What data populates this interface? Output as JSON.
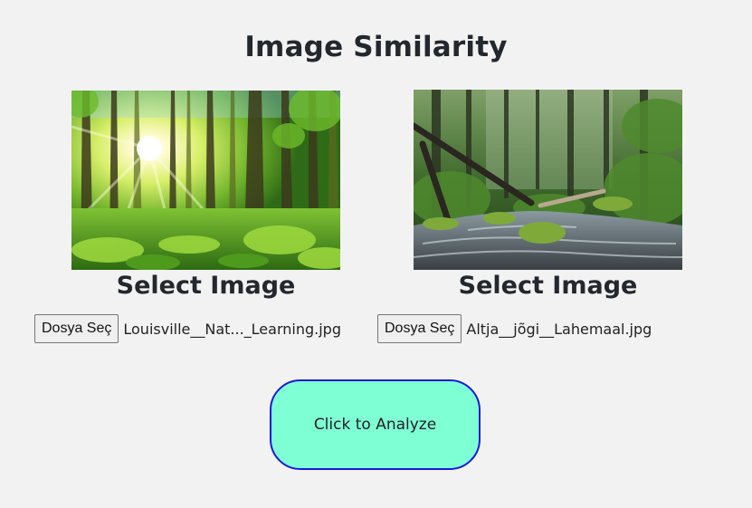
{
  "page": {
    "title": "Image Similarity"
  },
  "left_panel": {
    "select_label": "Select Image",
    "file_button_label": "Dosya Seç",
    "file_name": "Louisville__Nat..._Learning.jpg"
  },
  "right_panel": {
    "select_label": "Select Image",
    "file_button_label": "Dosya Seç",
    "file_name": "Altja__jõgi__Lahemaal.jpg"
  },
  "analyze": {
    "label": "Click to Analyze"
  },
  "colors": {
    "background": "#f2f2f2",
    "analyze_fill": "#7fffd4",
    "analyze_border": "#1a1ad8"
  }
}
